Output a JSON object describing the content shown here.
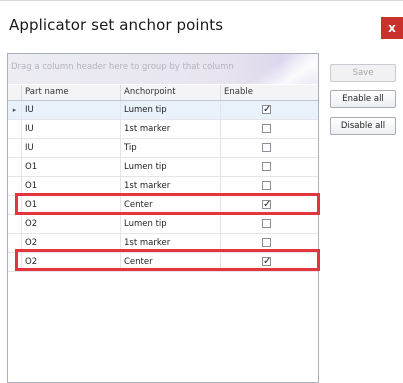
{
  "window": {
    "title": "Applicator set anchor points",
    "close_glyph": "x"
  },
  "grid": {
    "group_hint": "Drag a column header here to group by that column",
    "columns": [
      "Part name",
      "Anchorpoint",
      "Enable"
    ],
    "current_row_glyph": "▸",
    "rows": [
      {
        "part": "IU",
        "anchor": "Lumen tip",
        "enabled": true
      },
      {
        "part": "IU",
        "anchor": "1st marker",
        "enabled": false
      },
      {
        "part": "IU",
        "anchor": "Tip",
        "enabled": false
      },
      {
        "part": "O1",
        "anchor": "Lumen tip",
        "enabled": false
      },
      {
        "part": "O1",
        "anchor": "1st marker",
        "enabled": false
      },
      {
        "part": "O1",
        "anchor": "Center",
        "enabled": true
      },
      {
        "part": "O2",
        "anchor": "Lumen tip",
        "enabled": false
      },
      {
        "part": "O2",
        "anchor": "1st marker",
        "enabled": false
      },
      {
        "part": "O2",
        "anchor": "Center",
        "enabled": true
      }
    ]
  },
  "buttons": {
    "save": "Save",
    "enable_all": "Enable all",
    "disable_all": "Disable all"
  },
  "colors": {
    "close_button": "#c8312c",
    "highlight": "#e3353f",
    "selected_row": "#e9f2fb"
  },
  "icons": {
    "close": "close-icon",
    "checkbox_checked": "checkmark-icon",
    "current_row": "row-indicator-icon"
  }
}
